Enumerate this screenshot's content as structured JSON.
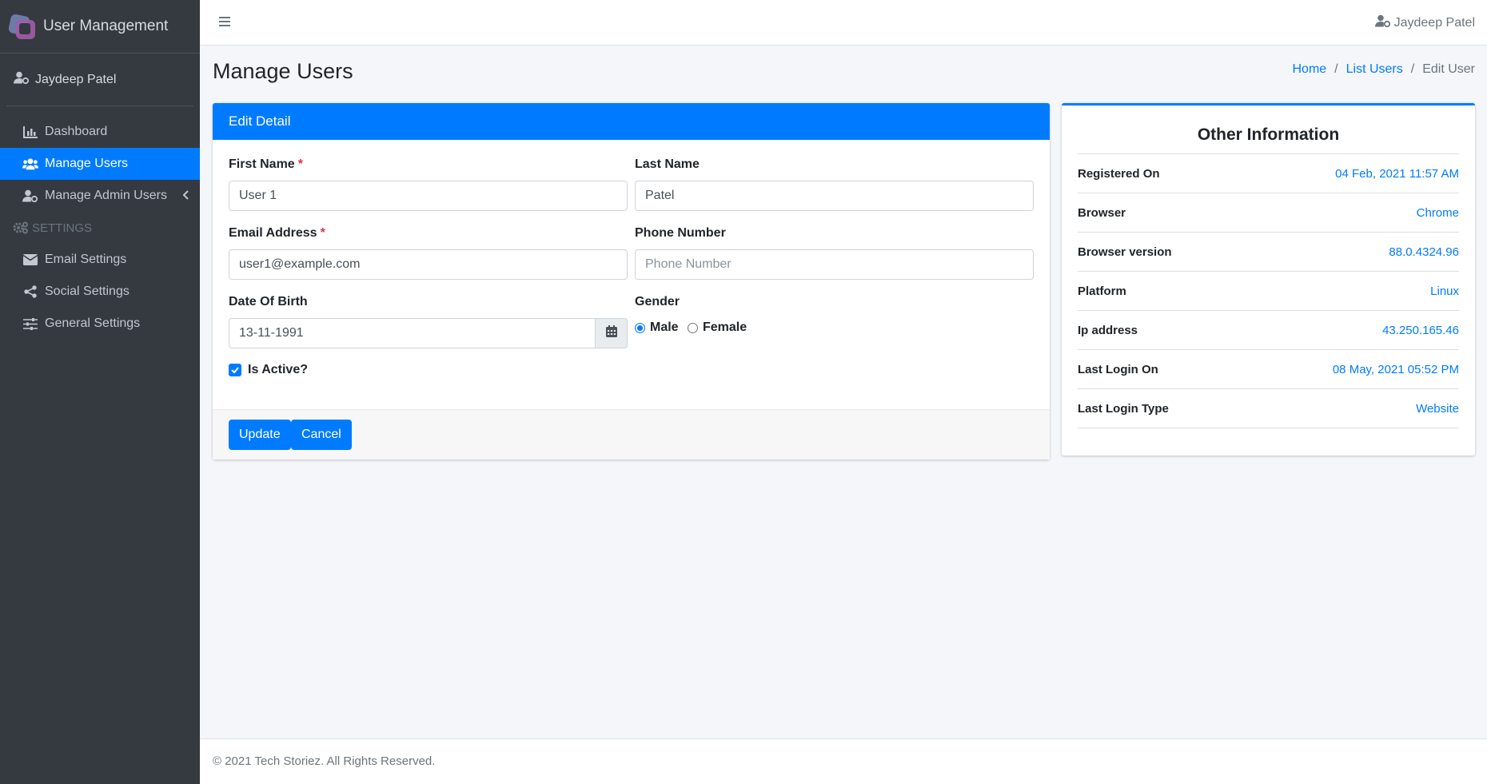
{
  "brand": {
    "title": "User Management"
  },
  "sidebar": {
    "user_name": "Jaydeep Patel",
    "items": [
      {
        "label": "Dashboard",
        "icon": "chart-bar-icon"
      },
      {
        "label": "Manage Users",
        "icon": "users-icon",
        "active": true
      },
      {
        "label": "Manage Admin Users",
        "icon": "user-shield-icon"
      }
    ],
    "settings_header": "SETTINGS",
    "settings_items": [
      {
        "label": "Email Settings",
        "icon": "envelope-icon"
      },
      {
        "label": "Social Settings",
        "icon": "share-icon"
      },
      {
        "label": "General Settings",
        "icon": "sliders-icon"
      }
    ]
  },
  "topbar": {
    "user_name": "Jaydeep Patel"
  },
  "header": {
    "title": "Manage Users",
    "breadcrumb": [
      "Home",
      "List Users",
      "Edit User"
    ]
  },
  "form": {
    "card_title": "Edit Detail",
    "first_name": {
      "label": "First Name",
      "value": "User 1",
      "required": "*"
    },
    "last_name": {
      "label": "Last Name",
      "value": "Patel"
    },
    "email": {
      "label": "Email Address",
      "value": "user1@example.com",
      "required": "*"
    },
    "phone": {
      "label": "Phone Number",
      "value": "",
      "placeholder": "Phone Number"
    },
    "dob": {
      "label": "Date Of Birth",
      "value": "13-11-1991"
    },
    "gender": {
      "label": "Gender",
      "options": [
        "Male",
        "Female"
      ],
      "selected": "Male"
    },
    "is_active": {
      "label": "Is Active?",
      "checked": true
    },
    "update_label": "Update",
    "cancel_label": "Cancel"
  },
  "info": {
    "title": "Other Information",
    "rows": [
      {
        "key": "Registered On",
        "value": "04 Feb, 2021 11:57 AM"
      },
      {
        "key": "Browser",
        "value": "Chrome"
      },
      {
        "key": "Browser version",
        "value": "88.0.4324.96"
      },
      {
        "key": "Platform",
        "value": "Linux"
      },
      {
        "key": "Ip address",
        "value": "43.250.165.46"
      },
      {
        "key": "Last Login On",
        "value": "08 May, 2021 05:52 PM"
      },
      {
        "key": "Last Login Type",
        "value": "Website"
      }
    ]
  },
  "footer": {
    "text": "© 2021 Tech Storiez. All Rights Reserved."
  },
  "colors": {
    "primary": "#007bff",
    "sidebar": "#343a40",
    "required": "#dc3545"
  }
}
